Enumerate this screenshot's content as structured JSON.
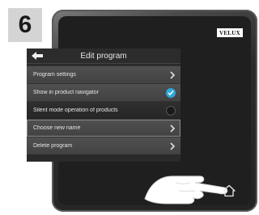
{
  "step": {
    "number": "6"
  },
  "device": {
    "brand_logo": "VELUX"
  },
  "screen": {
    "header_title": "Edit program",
    "back_icon": "back-arrow-icon",
    "items": [
      {
        "label": "Program settings",
        "control": "chevron-right-icon"
      },
      {
        "label": "Show in product navigator",
        "control": "check-circle-icon",
        "checked": true
      },
      {
        "label": "Silent mode operation of products",
        "control": "empty-circle-icon",
        "checked": false
      },
      {
        "label": "Choose new name",
        "control": "chevron-right-icon"
      },
      {
        "label": "Delete program",
        "control": "chevron-right-icon"
      }
    ]
  },
  "home": {
    "icon": "home-icon"
  },
  "colors": {
    "accent": "#2fa8dc",
    "bezel": "#232323"
  }
}
